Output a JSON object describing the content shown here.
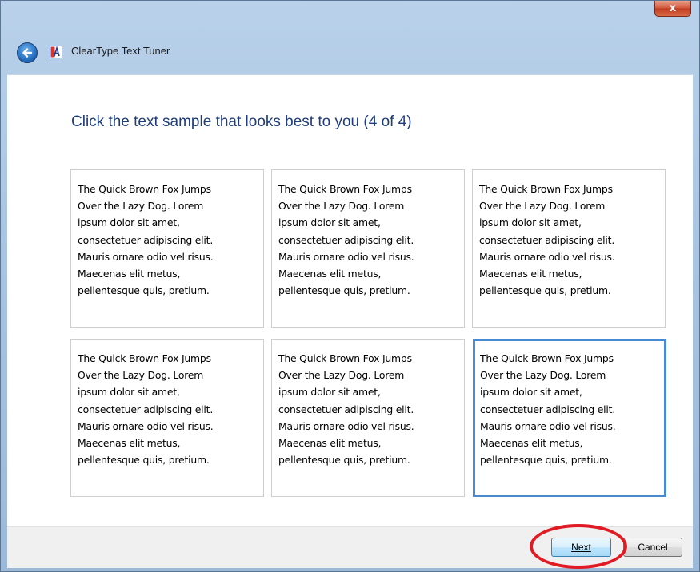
{
  "window": {
    "title": "ClearType Text Tuner",
    "close_label": "x"
  },
  "main": {
    "heading": "Click the text sample that looks best to you (4 of 4)",
    "samples": [
      {
        "text": "The Quick Brown Fox Jumps\nOver the Lazy Dog. Lorem\nipsum dolor sit amet,\nconsectetuer adipiscing elit.\nMauris ornare odio vel risus.\nMaecenas elit metus,\npellentesque quis, pretium.",
        "selected": false
      },
      {
        "text": "The Quick Brown Fox Jumps\nOver the Lazy Dog. Lorem\nipsum dolor sit amet,\nconsectetuer adipiscing elit.\nMauris ornare odio vel risus.\nMaecenas elit metus,\npellentesque quis, pretium.",
        "selected": false
      },
      {
        "text": "The Quick Brown Fox Jumps\nOver the Lazy Dog. Lorem\nipsum dolor sit amet,\nconsectetuer adipiscing elit.\nMauris ornare odio vel risus.\nMaecenas elit metus,\npellentesque quis, pretium.",
        "selected": false
      },
      {
        "text": "The Quick Brown Fox Jumps\nOver the Lazy Dog. Lorem\nipsum dolor sit amet,\nconsectetuer adipiscing elit.\nMauris ornare odio vel risus.\nMaecenas elit metus,\npellentesque quis, pretium.",
        "selected": false
      },
      {
        "text": "The Quick Brown Fox Jumps\nOver the Lazy Dog. Lorem\nipsum dolor sit amet,\nconsectetuer adipiscing elit.\nMauris ornare odio vel risus.\nMaecenas elit metus,\npellentesque quis, pretium.",
        "selected": false
      },
      {
        "text": "The Quick Brown Fox Jumps\nOver the Lazy Dog. Lorem\nipsum dolor sit amet,\nconsectetuer adipiscing elit.\nMauris ornare odio vel risus.\nMaecenas elit metus,\npellentesque quis, pretium.",
        "selected": true
      }
    ]
  },
  "footer": {
    "next_label": "Next",
    "cancel_label": "Cancel"
  },
  "icons": {
    "back": "back-arrow-icon",
    "app": "cleartype-icon"
  },
  "colors": {
    "heading": "#1f3d7a",
    "selected_border": "#4a8bd0",
    "highlight_ring": "#e01b24"
  }
}
